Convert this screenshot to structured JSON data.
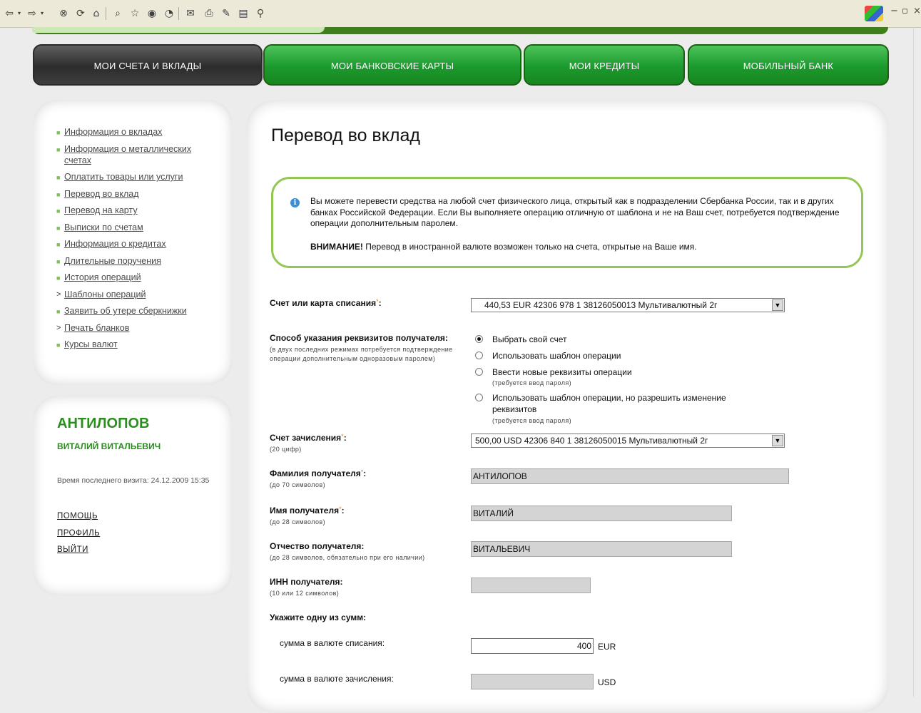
{
  "browser": {
    "buttons": [
      "back-icon",
      "forward-icon",
      "stop-icon",
      "refresh-icon",
      "home-icon",
      "search-icon",
      "favorites-icon",
      "media-icon",
      "history-icon",
      "mail-icon",
      "print-icon",
      "edit-icon",
      "discuss-icon",
      "research-icon"
    ],
    "window_controls": [
      "−",
      "🗗",
      "×"
    ]
  },
  "tabs": [
    {
      "label": "МОИ СЧЕТА И ВКЛАДЫ",
      "active": true
    },
    {
      "label": "МОИ БАНКОВСКИЕ КАРТЫ",
      "active": false
    },
    {
      "label": "МОИ КРЕДИТЫ",
      "active": false
    },
    {
      "label": "МОБИЛЬНЫЙ БАНК",
      "active": false
    }
  ],
  "sidebar": {
    "menu": [
      {
        "label": "Информация о вкладах",
        "bullet": "■"
      },
      {
        "label": "Информация о металлических счетах",
        "bullet": "■"
      },
      {
        "label": "Оплатить товары или услуги",
        "bullet": "■"
      },
      {
        "label": "Перевод во вклад",
        "bullet": "■"
      },
      {
        "label": "Перевод на карту",
        "bullet": "■"
      },
      {
        "label": "Выписки по счетам",
        "bullet": "■"
      },
      {
        "label": "Информация о кредитах",
        "bullet": "■"
      },
      {
        "label": "Длительные поручения",
        "bullet": "■"
      },
      {
        "label": "История операций",
        "bullet": "■"
      },
      {
        "label": "Шаблоны операций",
        "bullet": ">"
      },
      {
        "label": "Заявить об утере сберкнижки",
        "bullet": "■"
      },
      {
        "label": "Печать бланков",
        "bullet": ">"
      },
      {
        "label": "Курсы валют",
        "bullet": "■"
      }
    ]
  },
  "user": {
    "surname": "АНТИЛОПОВ",
    "names": "ВИТАЛИЙ ВИТАЛЬЕВИЧ",
    "last_visit": "Время последнего визита: 24.12.2009 15:35",
    "links": [
      "ПОМОЩЬ",
      "ПРОФИЛЬ",
      "ВЫЙТИ"
    ]
  },
  "page": {
    "title": "Перевод во вклад",
    "info_text": "Вы можете перевести средства на любой счет физического лица, открытый как в подразделении Сбербанка России, так и в других банках Российской Федерации. Если Вы выполняете операцию отличную от шаблона и не на Ваш счет, потребуется подтверждение операции дополнительным паролем.",
    "warning_bold": "ВНИМАНИЕ!",
    "warning_text": " Перевод в иностранной валюте возможен только на счета, открытые на Ваше имя."
  },
  "form": {
    "debit_label": "Счет или карта списания",
    "debit_value": "440,53 EUR 42306 978 1 38126050013 Мультивалютный 2г",
    "method_label": "Способ указания реквизитов получателя:",
    "method_hint": "(в двух последних режимах потребуется подтверждение операции дополнительным одноразовым паролем)",
    "method_options": [
      {
        "label": "Выбрать свой счет",
        "checked": true,
        "hint": ""
      },
      {
        "label": "Использовать шаблон операции",
        "checked": false,
        "hint": ""
      },
      {
        "label": "Ввести новые реквизиты операции",
        "checked": false,
        "hint": "(требуется ввод пароля)"
      },
      {
        "label": "Использовать шаблон операции, но разрешить изменение",
        "label2": "реквизитов",
        "checked": false,
        "hint": "(требуется ввод пароля)"
      }
    ],
    "credit_label": "Счет зачисления",
    "credit_hint": "(20 цифр)",
    "credit_value": "500,00 USD 42306 840 1 38126050015 Мультивалютный 2г",
    "surname_label": "Фамилия получателя",
    "surname_hint": "(до 70 символов)",
    "surname_value": "АНТИЛОПОВ",
    "name_label": "Имя получателя",
    "name_hint": "(до 28 символов)",
    "name_value": "ВИТАЛИЙ",
    "patronymic_label": "Отчество получателя:",
    "patronymic_hint": "(до 28 символов, обязательно при его наличии)",
    "patronymic_value": "ВИТАЛЬЕВИЧ",
    "inn_label": "ИНН получателя:",
    "inn_hint": "(10 или 12 символов)",
    "inn_value": "",
    "sum_header": "Укажите одну из сумм:",
    "sum_debit_label": "сумма в валюте списания:",
    "sum_debit_value": "400",
    "sum_debit_currency": "EUR",
    "sum_credit_label": "сумма в валюте зачисления:",
    "sum_credit_value": "",
    "sum_credit_currency": "USD",
    "required_mark": "*",
    "colon": ":"
  },
  "colors": {
    "accent_green": "#2b8f1e",
    "tab_green": "#1b9a2e",
    "info_border": "#93c753"
  }
}
